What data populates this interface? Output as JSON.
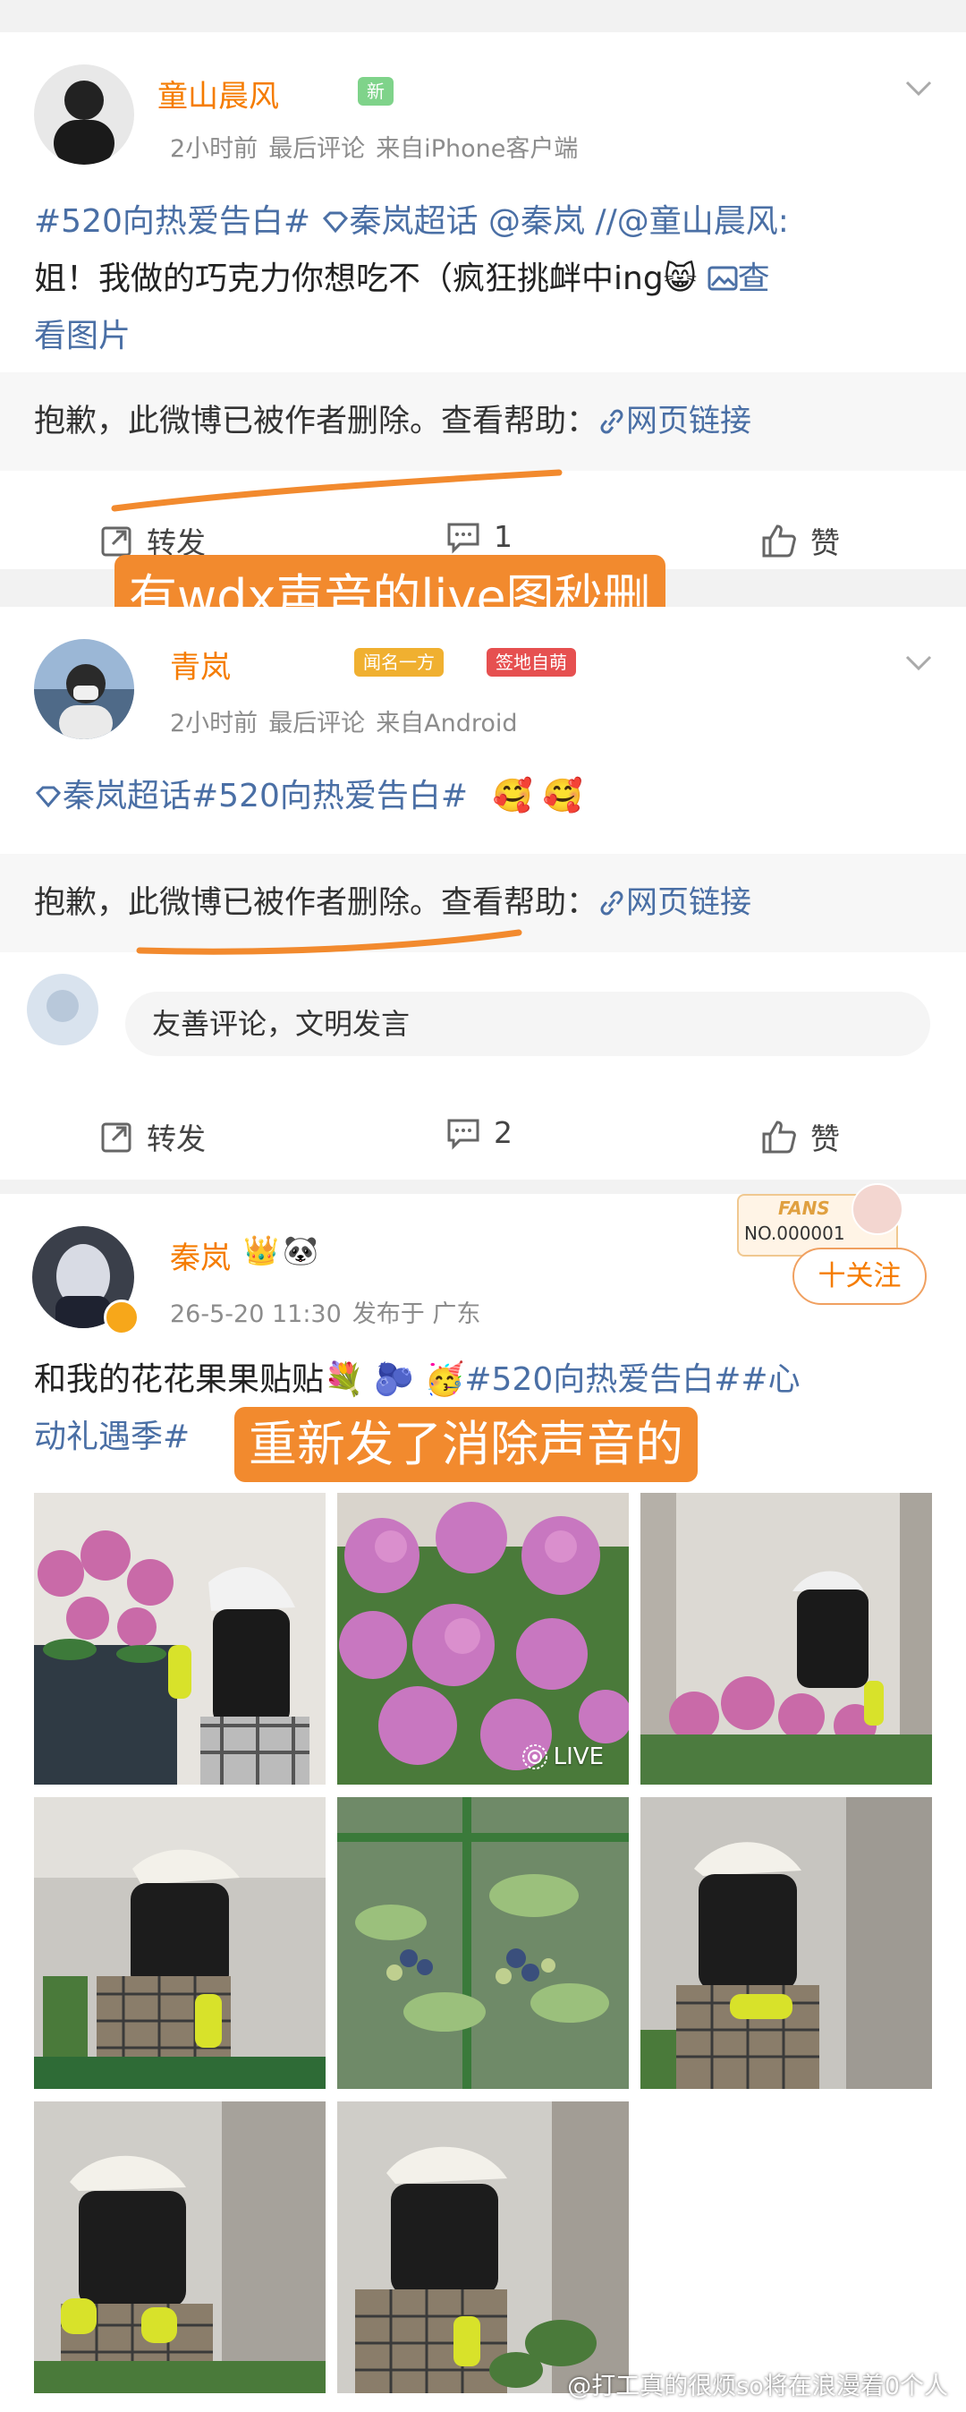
{
  "post1": {
    "username": "童山晨风",
    "badge": "新",
    "time": "2小时前",
    "last_comment": "最后评论",
    "source": "来自iPhone客户端",
    "text_line1_a": "#520向热爱告白#",
    "text_line1_b": "秦岚超话",
    "text_line1_c": "@秦岚",
    "text_line1_d": "//@童山晨风:",
    "text_line2": "姐！我做的巧克力你想吃不（疯狂挑衅中ing",
    "text_view_img": "查",
    "text_line3": "看图片",
    "deleted_text": "抱歉，此微博已被作者删除。查看帮助：",
    "web_link": "网页链接",
    "repost": "转发",
    "comments": "1",
    "like": "赞",
    "annotation": "有wdx声音的live图秒删"
  },
  "post2": {
    "username": "青岚",
    "badge1": "闻名一方",
    "badge2": "签地自萌",
    "time": "2小时前",
    "last_comment": "最后评论",
    "source": "来自Android",
    "text": "秦岚超话#520向热爱告白#",
    "deleted_text_a": "抱歉，",
    "deleted_text_b": "此微博已被作者删除。",
    "deleted_text_c": "查看帮助：",
    "web_link": "网页链接",
    "comment_placeholder": "友善评论，文明发言",
    "repost": "转发",
    "comments": "2",
    "like": "赞"
  },
  "post3": {
    "username": "秦岚",
    "fans_label": "FANS",
    "fans_no": "NO.000001",
    "follow": "十关注",
    "time": "26-5-20 11:30",
    "location": "发布于 广东",
    "text_line1_a": "和我的花花果果贴贴",
    "text_line1_b": "#520向热爱告白##心",
    "text_line2": "动礼遇季#",
    "annotation": "重新发了消除声音的",
    "live_label": "LIVE",
    "watermark": "@打工真的很烦so将在浪漫着0个人"
  },
  "colors": {
    "accent_orange": "#f28a2e",
    "link_blue": "#4a6fa5",
    "username_orange": "#f57c00"
  }
}
